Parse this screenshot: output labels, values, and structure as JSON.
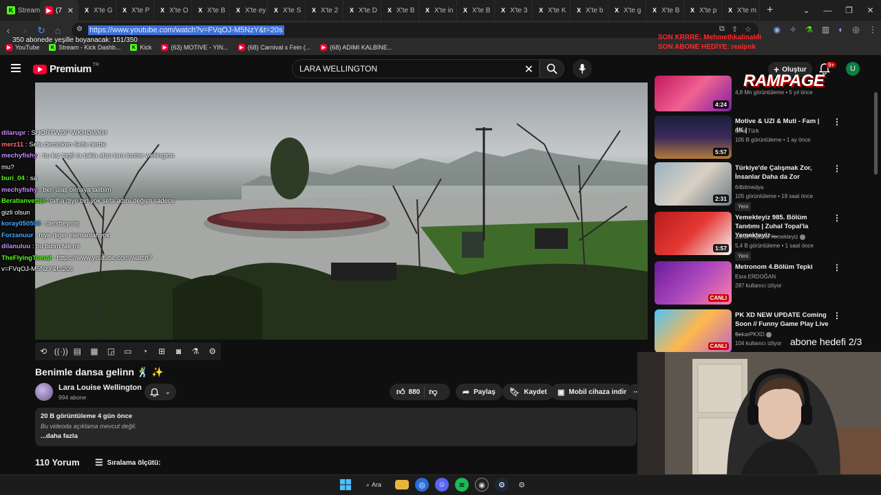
{
  "browser": {
    "tabs": [
      {
        "label": "Stream",
        "favicon": "kick",
        "active": false
      },
      {
        "label": "(7",
        "favicon": "youtube",
        "active": true
      },
      {
        "label": "X'te G",
        "favicon": "x",
        "active": false
      },
      {
        "label": "X'te P",
        "favicon": "x",
        "active": false
      },
      {
        "label": "X'te O",
        "favicon": "x",
        "active": false
      },
      {
        "label": "X'te B",
        "favicon": "x",
        "active": false
      },
      {
        "label": "X'te ey",
        "favicon": "x",
        "active": false
      },
      {
        "label": "X'te S",
        "favicon": "x",
        "active": false
      },
      {
        "label": "X'te 2",
        "favicon": "x",
        "active": false
      },
      {
        "label": "X'te D",
        "favicon": "x",
        "active": false
      },
      {
        "label": "X'te B",
        "favicon": "x",
        "active": false
      },
      {
        "label": "X'te in",
        "favicon": "x",
        "active": false
      },
      {
        "label": "X'te B",
        "favicon": "x",
        "active": false
      },
      {
        "label": "X'te 3",
        "favicon": "x",
        "active": false
      },
      {
        "label": "X'te K",
        "favicon": "x",
        "active": false
      },
      {
        "label": "X'te b",
        "favicon": "x",
        "active": false
      },
      {
        "label": "X'te g",
        "favicon": "x",
        "active": false
      },
      {
        "label": "X'te B",
        "favicon": "x",
        "active": false
      },
      {
        "label": "X'te p",
        "favicon": "x",
        "active": false
      },
      {
        "label": "X'te m",
        "favicon": "x",
        "active": false
      }
    ],
    "url": "https://www.youtube.com/watch?v=FVqOJ-M5NzY&t=20s",
    "bookmarks": [
      {
        "label": "YouTube",
        "favicon": "youtube"
      },
      {
        "label": "Stream - Kick Dashb...",
        "favicon": "kick"
      },
      {
        "label": "Kick",
        "favicon": "kick"
      },
      {
        "label": "(63) MOTIVE - YIN...",
        "favicon": "youtube"
      },
      {
        "label": "(68) Carnival x Fein (...",
        "favicon": "youtube"
      },
      {
        "label": "(68) ADIMI KALBİNE...",
        "favicon": "youtube"
      }
    ]
  },
  "overlays": {
    "subscriber_goal": "350 abonede yeşille boyanacak: 151/350",
    "red_line1": "SON KRRRE: Mehmethkalinaldi",
    "red_line2": "SON ABONE HEDİYE: reaipnk",
    "rampage_logo": "RAMPAGE",
    "abone_hedefi": "abone hedefi 2/3"
  },
  "youtube": {
    "logo_text": "Premium",
    "logo_region": "TR",
    "search_value": "LARA WELLINGTON",
    "create_label": "Oluştur",
    "notif_badge": "9+",
    "avatar_letter": "U"
  },
  "chat": [
    {
      "user": "dilarupr",
      "text": "SHORTWOP WKHOWKH",
      "color": "#c58af9"
    },
    {
      "user": "merz11",
      "text": "Sefa demisken Sefa nerde",
      "color": "#ff6b6b"
    },
    {
      "user": "mechyfishy",
      "text": "bu kız big5 ta takla atan lara louise wellington mu?",
      "color": "#c58af9"
    },
    {
      "user": "buri_04",
      "text": "sa",
      "color": "#53fc18"
    },
    {
      "user": "mechyfishy",
      "text": "ben ulaş olmaya talibim",
      "color": "#c58af9"
    },
    {
      "user": "Beratianvettel",
      "text": "talha diye biri yok sefa adını değişti sadece gizli olsun",
      "color": "#53fc18"
    },
    {
      "user": "koray050509",
      "text": "derstteymiş",
      "color": "#4aa3ff"
    },
    {
      "user": "Forzanuur",
      "text": "niye diger elemanlar yok",
      "color": "#4aa3ff"
    },
    {
      "user": "dilanuluu",
      "text": "bu bizim fati mi",
      "color": "#c58af9"
    },
    {
      "user": "TheFlyingTomat",
      "text": "https://www.youtube.com/watch?v=FVqOJ-M5NzY&t=20s",
      "color": "#53fc18"
    }
  ],
  "video": {
    "title": "Benimle dansa gelinn 🕺 ✨",
    "channel": "Lara Louise Wellington",
    "subscribers": "994 abone",
    "likes": "880",
    "share_label": "Paylaş",
    "save_label": "Kaydet",
    "mobile_label": "Mobil cihaza indir",
    "views_date": "20 B görüntüleme  4 gün önce",
    "description": "Bu videoda açıklama mevcut değil.",
    "more_label": "...daha fazla",
    "comments_count": "110 Yorum",
    "sort_label": "Sıralama ölçütü:"
  },
  "recommendations": [
    {
      "title": "",
      "channel": "",
      "meta": "4,8 Mn görüntüleme • 5 yıl önce",
      "duration": "4:24",
      "thumb": "pink",
      "tag": ""
    },
    {
      "title": "Motive & UZI & Muti - Fam | 4K |",
      "channel": "Emir Türk",
      "meta": "105 B görüntüleme • 1 ay önce",
      "duration": "5:57",
      "thumb": "stage",
      "tag": ""
    },
    {
      "title": "Türkiye'de Çalışmak Zor, İnsanlar Daha da Zor",
      "channel": "64bitmedya",
      "meta": "105 görüntüleme • 19 saat önce",
      "duration": "2:31",
      "thumb": "man",
      "tag": "Yeni"
    },
    {
      "title": "Yemekteyiz 985. Bölüm Tanıtımı | Zuhal Topal'la Yemekteyiz ...",
      "channel": "Zuhal Topal'la Yemekteyiz",
      "meta": "5,4 B görüntüleme • 1 saat önce",
      "duration": "1:57",
      "thumb": "red",
      "tag": "Yeni",
      "verified": true
    },
    {
      "title": "Metronom 4.Bölüm Tepki",
      "channel": "Esra ERDOĞAN",
      "meta": "287 kullanıcı izliyor",
      "duration": "CANLI",
      "thumb": "purple",
      "tag": "",
      "live": true
    },
    {
      "title": "PK XD NEW UPDATE Coming Soon // Funny Game Play Live ...",
      "channel": "SekarPKXD",
      "meta": "104 kullanıcı izliyor",
      "duration": "CANLI",
      "thumb": "game",
      "tag": "",
      "live": true,
      "verified": true
    }
  ],
  "taskbar": {
    "search_label": "Ara"
  }
}
